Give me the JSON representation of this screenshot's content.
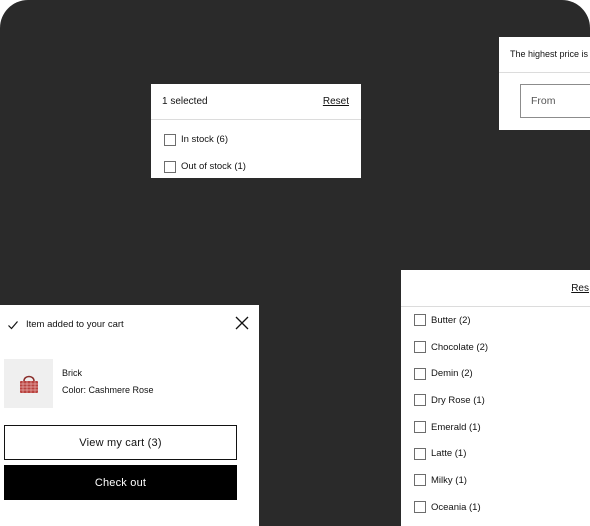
{
  "availability_filter": {
    "selected_count_text": "1 selected",
    "reset_label": "Reset",
    "options": [
      {
        "label": "In stock (6)"
      },
      {
        "label": "Out of stock (1)"
      }
    ]
  },
  "price_filter": {
    "highest_price_text": "The highest price is",
    "from_placeholder": "From"
  },
  "color_filter": {
    "reset_label": "Res",
    "options": [
      {
        "label": "Butter (2)"
      },
      {
        "label": "Chocolate (2)"
      },
      {
        "label": "Demin (2)"
      },
      {
        "label": "Dry Rose (1)"
      },
      {
        "label": "Emerald (1)"
      },
      {
        "label": "Latte (1)"
      },
      {
        "label": "Milky (1)"
      },
      {
        "label": "Oceania (1)"
      }
    ]
  },
  "cart_notification": {
    "added_text": "Item added to your cart",
    "product_name": "Brick",
    "product_variant": "Color: Cashmere Rose",
    "view_cart_label": "View my cart (3)",
    "checkout_label": "Check out"
  },
  "colors": {
    "background": "#2a2a2a",
    "panel": "#ffffff",
    "checkout_button": "#000000",
    "product_bag": "#b8433f"
  }
}
